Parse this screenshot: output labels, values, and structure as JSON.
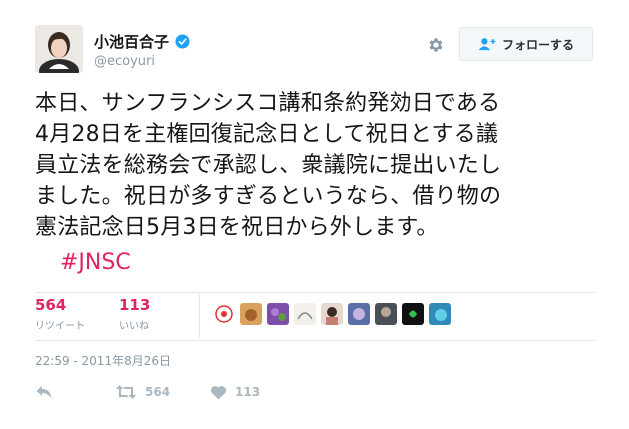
{
  "user": {
    "display_name": "小池百合子",
    "handle": "@ecoyuri"
  },
  "follow_button": {
    "label": "フォローする"
  },
  "tweet": {
    "text_lines": [
      "本日、サンフランシスコ講和条約発効日である",
      "4月28日を主権回復記念日として祝日とする議",
      "員立法を総務会で承認し、衆議院に提出いたし",
      "ました。祝日が多すぎるというなら、借り物の",
      "憲法記念日5月3日を祝日から外します。"
    ],
    "hashtag": "#JNSC"
  },
  "stats": {
    "retweets": {
      "count": "564",
      "label": "リツイート"
    },
    "likes": {
      "count": "113",
      "label": "いいね"
    }
  },
  "timestamp": "22:59 - 2011年8月26日",
  "actions": {
    "retweet_count": "564",
    "like_count": "113"
  },
  "colors": {
    "accent": "#e0245e",
    "verified": "#1da1f2",
    "muted": "#8899a6",
    "icon": "#aab8c2"
  },
  "icons": [
    "verified-badge-icon",
    "gear-icon",
    "follow-user-plus-icon",
    "reply-icon",
    "retweet-icon",
    "heart-icon"
  ]
}
